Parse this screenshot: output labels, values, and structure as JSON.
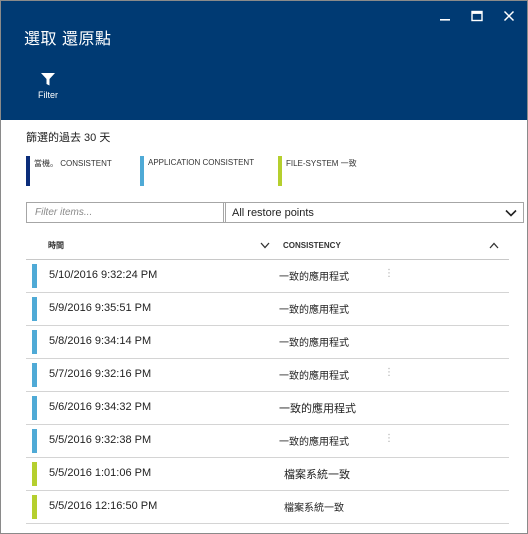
{
  "window": {
    "title": "選取 還原點",
    "minimize_glyph": "—",
    "maximize_glyph": "▭",
    "close_glyph": "✕"
  },
  "toolbar": {
    "filter_label": "Filter"
  },
  "summary": "篩選的過去 30 天",
  "legend": [
    {
      "label": "當機。 CONSISTENT",
      "color": "#0b2d7a"
    },
    {
      "label": "APPLICATION CONSISTENT",
      "color": "#4faad6"
    },
    {
      "label": "FILE-SYSTEM 一致",
      "color": "#b5cf2e"
    }
  ],
  "search": {
    "placeholder": "Filter items..."
  },
  "dropdown": {
    "selected": "All restore points"
  },
  "table": {
    "columns": [
      "時間",
      "CONSISTENCY"
    ],
    "rows": [
      {
        "time": "5/10/2016 9:32:24 PM",
        "consistency": "一致的應用程式",
        "color": "#4faad6",
        "dots": "⋮"
      },
      {
        "time": "5/9/2016 9:35:51 PM",
        "consistency": "一致的應用程式",
        "color": "#4faad6",
        "dots": ""
      },
      {
        "time": "5/8/2016 9:34:14 PM",
        "consistency": "一致的應用程式",
        "color": "#4faad6",
        "dots": ""
      },
      {
        "time": "5/7/2016 9:32:16 PM",
        "consistency": "一致的應用程式",
        "color": "#4faad6",
        "dots": "⋮"
      },
      {
        "time": "5/6/2016 9:34:32 PM",
        "consistency": "一致的應用程式",
        "color": "#4faad6",
        "dots": ""
      },
      {
        "time": "5/5/2016 9:32:38 PM",
        "consistency": "一致的應用程式",
        "color": "#4faad6",
        "dots": "⋮"
      },
      {
        "time": "5/5/2016 1:01:06 PM",
        "consistency": "檔案系統一致",
        "color": "#b5cf2e",
        "dots": ""
      },
      {
        "time": "5/5/2016 12:16:50 PM",
        "consistency": "檔案系統一致",
        "color": "#b5cf2e",
        "dots": ""
      }
    ]
  }
}
